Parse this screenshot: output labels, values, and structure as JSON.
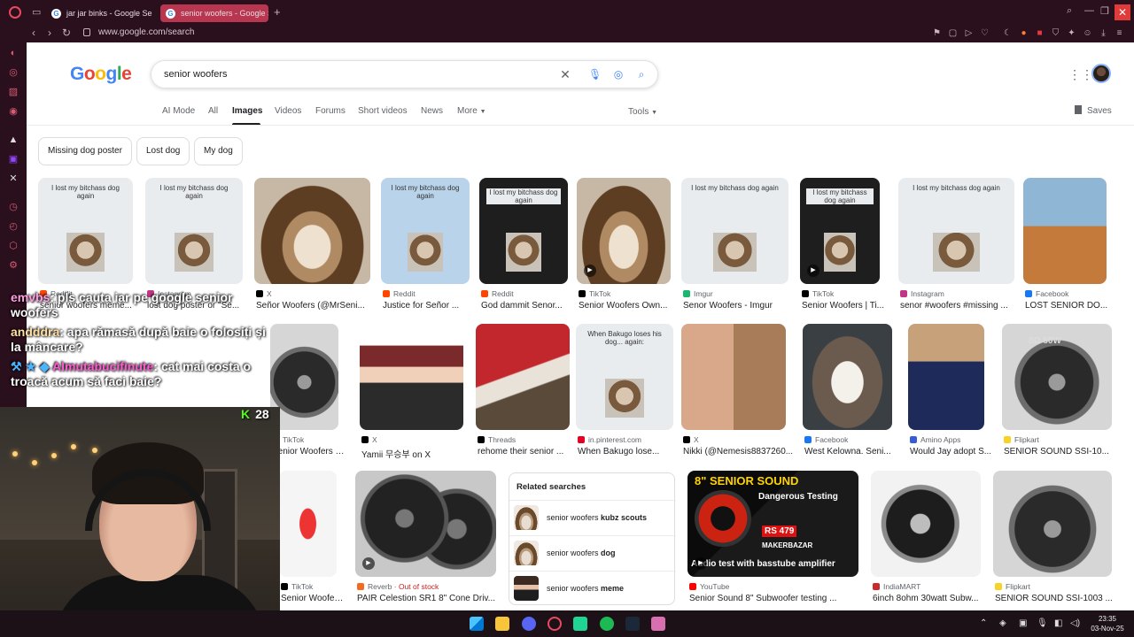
{
  "browser": {
    "tabs": [
      {
        "label": "jar jar binks - Google Se",
        "active": false
      },
      {
        "label": "senior woofers - Google S",
        "active": true
      }
    ],
    "url": "www.google.com/search"
  },
  "google": {
    "search_query": "senior woofers",
    "nav_tabs": [
      "AI Mode",
      "All",
      "Images",
      "Videos",
      "Forums",
      "Short videos",
      "News",
      "More"
    ],
    "active_tab": "Images",
    "tools_label": "Tools",
    "saves_label": "Saves",
    "chips": [
      "Missing dog poster",
      "Lost dog",
      "My dog"
    ]
  },
  "results_row1": [
    {
      "source": "Reddit",
      "title": "senior woofers meme...",
      "color": "#ff4500"
    },
    {
      "source": "Instagram",
      "title": "lost dog poster or \"Se...",
      "color": "#c13584"
    },
    {
      "source": "X",
      "title": "Señor Woofers (@MrSeni...",
      "color": "#000000"
    },
    {
      "source": "Reddit",
      "title": "Justice for Señor ...",
      "color": "#ff4500"
    },
    {
      "source": "Reddit",
      "title": "God dammit Senor...",
      "color": "#ff4500"
    },
    {
      "source": "TikTok",
      "title": "Senior Woofers Own...",
      "color": "#000000"
    },
    {
      "source": "Imgur",
      "title": "Senor Woofers - Imgur",
      "color": "#1bb76e"
    },
    {
      "source": "TikTok",
      "title": "Senior Woofers | Ti...",
      "color": "#000000"
    },
    {
      "source": "Instagram",
      "title": "senor #woofers #missing ...",
      "color": "#c13584"
    },
    {
      "source": "Facebook",
      "title": "LOST SENIOR DO...",
      "color": "#1877f2"
    }
  ],
  "results_row2": [
    {
      "source": "TikTok",
      "title": "Senior Woofers Me...",
      "color": "#000000"
    },
    {
      "source": "X",
      "title": "Yamii 무승부 on X",
      "color": "#000000"
    },
    {
      "source": "Threads",
      "title": "rehome their senior ...",
      "color": "#000000"
    },
    {
      "source": "in.pinterest.com",
      "title": "When Bakugo lose...",
      "color": "#e60023"
    },
    {
      "source": "X",
      "title": "Nikki (@Nemesis8837260...",
      "color": "#000000"
    },
    {
      "source": "Facebook",
      "title": "West Kelowna. Seni...",
      "color": "#1877f2"
    },
    {
      "source": "Amino Apps",
      "title": "Would Jay adopt S...",
      "color": "#3a5bd9"
    },
    {
      "source": "Flipkart",
      "title": "SENIOR SOUND SSI-10...",
      "color": "#f8d322"
    }
  ],
  "results_row3": [
    {
      "source": "TikTok",
      "title": "Senior Woofers Ja...",
      "color": "#000000"
    },
    {
      "source": "Reverb",
      "title": "PAIR Celestion SR1 8\" Cone Driv...",
      "color": "#f36a21",
      "badge": "Out of stock"
    },
    {
      "source": "YouTube",
      "title": "Senior Sound 8\" Subwoofer testing ...",
      "color": "#ff0000"
    },
    {
      "source": "IndiaMART",
      "title": "6inch 8ohm 30watt Subw...",
      "color": "#c92a2a"
    },
    {
      "source": "Flipkart",
      "title": "SENIOR SOUND SSI-1003 ...",
      "color": "#f8d322"
    }
  ],
  "related": {
    "heading": "Related searches",
    "items": [
      {
        "base": "senior woofers",
        "bold": "kubz scouts"
      },
      {
        "base": "senior woofers",
        "bold": "dog"
      },
      {
        "base": "senior woofers",
        "bold": "meme"
      }
    ]
  },
  "thumb_text": {
    "poster": "I lost my bitchass dog again",
    "bakugo": "When Bakugo loses his dog... again:",
    "senior_sound": "8\" SENIOR SOUND",
    "dangerous": "Dangerous Testing",
    "price": "RS 479",
    "maker": "MAKERBAZAR",
    "audio_test": "Audio test with basstube amplifier",
    "speaker_label": "8Ω 50W"
  },
  "chat": [
    {
      "user": "emvbs",
      "text": "pls cauta iar pe google senior woofers"
    },
    {
      "user": "andddra",
      "text": "apa rămasă după baie o folosiți și la mâncare?"
    },
    {
      "user": "Almutabucifinute",
      "text": "cat mai costa o troacă acum să faci baie?"
    }
  ],
  "stream": {
    "viewers": "28"
  },
  "clock": {
    "time": "23:35",
    "date": "03-Nov-25"
  }
}
